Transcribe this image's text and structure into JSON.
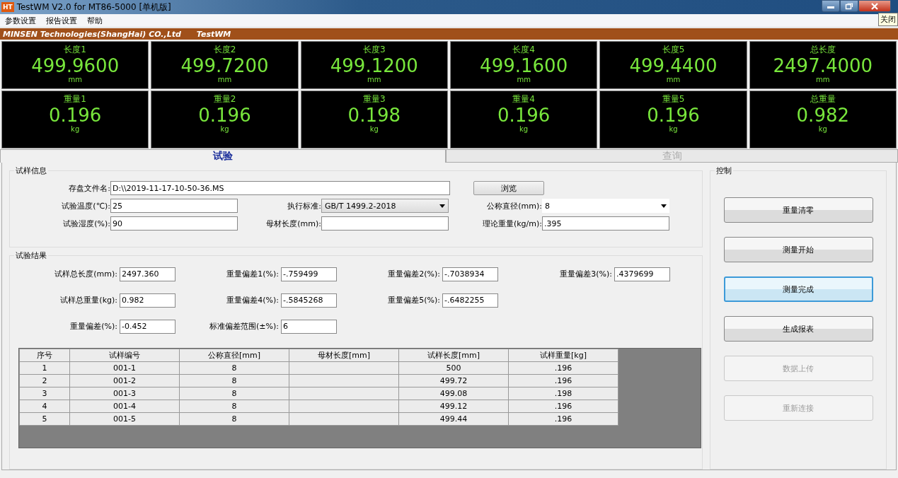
{
  "window": {
    "title": "TestWM V2.0 for MT86-5000 [单机版]",
    "app_icon": "HT",
    "tooltip": "关闭"
  },
  "menu": [
    "参数设置",
    "报告设置",
    "帮助"
  ],
  "banner": {
    "company": "MINSEN Technologies(ShangHai) CO.,Ltd",
    "product": "TestWM"
  },
  "meters": [
    [
      {
        "label": "长度1",
        "value": "499.9600",
        "unit": "mm"
      },
      {
        "label": "长度2",
        "value": "499.7200",
        "unit": "mm"
      },
      {
        "label": "长度3",
        "value": "499.1200",
        "unit": "mm"
      },
      {
        "label": "长度4",
        "value": "499.1600",
        "unit": "mm"
      },
      {
        "label": "长度5",
        "value": "499.4400",
        "unit": "mm"
      },
      {
        "label": "总长度",
        "value": "2497.4000",
        "unit": "mm"
      }
    ],
    [
      {
        "label": "重量1",
        "value": "0.196",
        "unit": "kg"
      },
      {
        "label": "重量2",
        "value": "0.196",
        "unit": "kg"
      },
      {
        "label": "重量3",
        "value": "0.198",
        "unit": "kg"
      },
      {
        "label": "重量4",
        "value": "0.196",
        "unit": "kg"
      },
      {
        "label": "重量5",
        "value": "0.196",
        "unit": "kg"
      },
      {
        "label": "总重量",
        "value": "0.982",
        "unit": "kg"
      }
    ]
  ],
  "tabs": [
    {
      "label": "试验",
      "selected": true
    },
    {
      "label": "查询",
      "selected": false
    }
  ],
  "sample_info": {
    "title": "试样信息",
    "file": {
      "label": "存盘文件名:",
      "value": "D:\\\\2019-11-17-10-50-36.MS",
      "button": "浏览"
    },
    "fields": [
      {
        "label": "试验温度(℃):",
        "value": "25",
        "kind": "text"
      },
      {
        "label": "执行标准:",
        "value": "GB/T 1499.2-2018",
        "kind": "combo"
      },
      {
        "label": "公称直径(mm):",
        "value": "8",
        "kind": "dropdown"
      },
      {
        "label": "试验湿度(%):",
        "value": "90",
        "kind": "text"
      },
      {
        "label": "母材长度(mm):",
        "kind": "text"
      },
      {
        "label": "理论重量(kg/m):",
        "value": ".395",
        "kind": "text"
      }
    ]
  },
  "results": {
    "title": "试验结果",
    "fields": [
      {
        "label": "试样总长度(mm):",
        "value": "2497.360"
      },
      {
        "label": "重量偏差1(%):",
        "value": "-.759499"
      },
      {
        "label": "重量偏差2(%):",
        "value": "-.7038934"
      },
      {
        "label": "重量偏差3(%):",
        "value": ".4379699"
      },
      {
        "label": "试样总重量(kg):",
        "value": "0.982"
      },
      {
        "label": "重量偏差4(%):",
        "value": "-.5845268"
      },
      {
        "label": "重量偏差5(%):",
        "value": "-.6482255"
      },
      {
        "label": "重量偏差(%):",
        "value": "-0.452"
      },
      {
        "label": "标准偏差范围(±%):",
        "value": "6"
      }
    ]
  },
  "table": {
    "columns": [
      "序号",
      "试样编号",
      "公称直径[mm]",
      "母材长度[mm]",
      "试样长度[mm]",
      "试样重量[kg]"
    ],
    "rows": [
      [
        "1",
        "001-1",
        "8",
        "",
        "500",
        ".196"
      ],
      [
        "2",
        "001-2",
        "8",
        "",
        "499.72",
        ".196"
      ],
      [
        "3",
        "001-3",
        "8",
        "",
        "499.08",
        ".198"
      ],
      [
        "4",
        "001-4",
        "8",
        "",
        "499.12",
        ".196"
      ],
      [
        "5",
        "001-5",
        "8",
        "",
        "499.44",
        ".196"
      ]
    ]
  },
  "control": {
    "title": "控制",
    "buttons": [
      {
        "label": "重量清零",
        "focused": false,
        "disabled": false
      },
      {
        "label": "测量开始",
        "focused": false,
        "disabled": false
      },
      {
        "label": "测量完成",
        "focused": true,
        "disabled": false
      },
      {
        "label": "生成报表",
        "focused": false,
        "disabled": false
      },
      {
        "label": "数据上传",
        "focused": false,
        "disabled": true
      },
      {
        "label": "重新连接",
        "focused": false,
        "disabled": true
      }
    ]
  }
}
